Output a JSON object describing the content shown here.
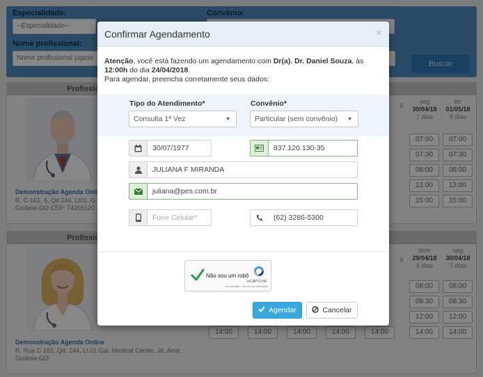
{
  "search": {
    "especialidade_label": "Especialidade:",
    "especialidade_value": "--Especialidade--",
    "convenio_label": "Convênio:",
    "nome_label": "Nome profissional:",
    "nome_placeholder": "Nome profissional (opcio",
    "buscar_label": "Buscar"
  },
  "cards": [
    {
      "header": "Profissio",
      "link": "Demonstração Agenda Online",
      "address": "R. C-161, 6, Qd 244, Lt01, G\nGoiânia-GO CEP: 74255120",
      "days": [
        {
          "name": "seg",
          "date": "30/04/18",
          "rel": "7 dias"
        },
        {
          "name": "ter",
          "date": "01/05/18",
          "rel": "8 dias"
        }
      ],
      "hidden_date": "8",
      "slots": [
        [
          "07:00",
          "07:00"
        ],
        [
          "07:30",
          "07:30"
        ],
        [
          "08:00",
          "08:00"
        ],
        [
          "12:00",
          "12:00"
        ],
        [
          "15:00",
          "15:00"
        ]
      ]
    },
    {
      "header": "Profissio",
      "link": "Demonstração Agenda Online",
      "address": "R. Rua C-161, Qd. 244, Lt.01 Gal. Medical Center, Jd. Amé,\nGoiânia-GO",
      "days": [
        {
          "name": "dom",
          "date": "29/04/18",
          "rel": "6 dias"
        },
        {
          "name": "seg",
          "date": "30/04/18",
          "rel": "7 dias"
        }
      ],
      "hidden_date": "8",
      "slots": [
        [
          "08:00",
          "08:00"
        ],
        [
          "08:30",
          "08:30"
        ],
        [
          "12:00",
          "12:00"
        ],
        [
          "14:00",
          "14:00"
        ]
      ],
      "bottom_row": [
        "14:00",
        "14:00",
        "14:00",
        "14:00",
        "14:00"
      ]
    }
  ],
  "modal": {
    "title": "Confirmar Agendamento",
    "close_glyph": "×",
    "notice_attention": "Atenção",
    "notice_p1": ", você está fazendo um agendamento com ",
    "notice_doctor": "Dr(a). Dr. Daniel Souza",
    "notice_p2": ", às ",
    "notice_time": "12:00h",
    "notice_p3": " do dia ",
    "notice_date": "24/04/2018",
    "notice_p4": ".",
    "notice_line2": "Para agendar, preencha corretamente seus dados:",
    "tipo_label": "Tipo do Atendimento*",
    "tipo_value": "Consulta 1ª Vez",
    "convenio_label": "Convênio*",
    "convenio_value": "Particular (sem convênio)",
    "birth_date": "30/07/1977",
    "cpf": "837.120.130-35",
    "name": "JULIANA F MIRANDA",
    "email": "juliana@pes.com.br",
    "cell_placeholder": "Fone Celular*",
    "phone": "(62) 3286-5300",
    "captcha_text": "Não sou um robô",
    "captcha_brand": "reCAPTCHA",
    "captcha_terms": "Privacidade - Termos de Utilização",
    "agendar_label": "Agendar",
    "cancelar_label": "Cancelar"
  },
  "colors": {
    "header_blue": "#4f8fc3",
    "primary_button": "#38a9e0",
    "valid_green": "#7fb67f",
    "link_blue": "#3a6fb0"
  }
}
